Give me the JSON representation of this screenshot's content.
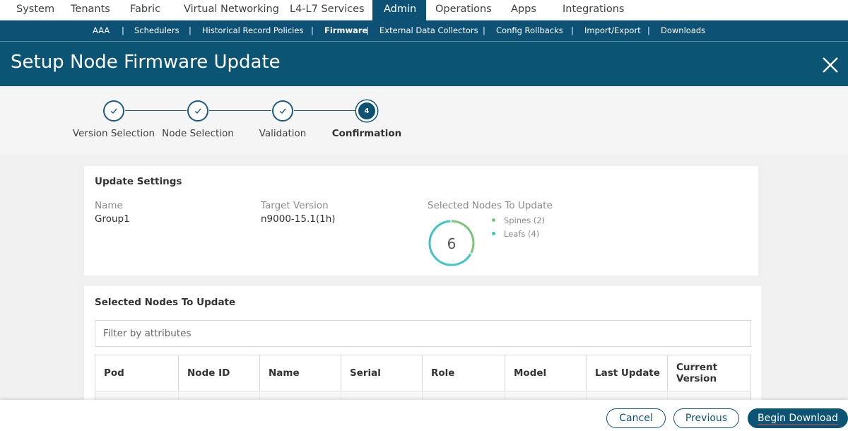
{
  "topnav": {
    "tabs": [
      {
        "label": "System"
      },
      {
        "label": "Tenants"
      },
      {
        "label": "Fabric"
      },
      {
        "label": "Virtual Networking"
      },
      {
        "label": "L4-L7 Services"
      },
      {
        "label": "Admin"
      },
      {
        "label": "Operations"
      },
      {
        "label": "Apps"
      },
      {
        "label": "Integrations"
      }
    ],
    "active": "Admin"
  },
  "subnav": {
    "items": [
      {
        "label": "AAA"
      },
      {
        "label": "Schedulers"
      },
      {
        "label": "Historical Record Policies"
      },
      {
        "label": "Firmware"
      },
      {
        "label": "External Data Collectors"
      },
      {
        "label": "Config Rollbacks"
      },
      {
        "label": "Import/Export"
      },
      {
        "label": "Downloads"
      }
    ],
    "separator": "|",
    "active": "Firmware"
  },
  "dialog": {
    "title": "Setup Node Firmware Update",
    "close_icon": "close-icon"
  },
  "stepper": {
    "steps": [
      {
        "label": "Version Selection",
        "status": "done",
        "icon": "check-icon"
      },
      {
        "label": "Node Selection",
        "status": "done",
        "icon": "check-icon"
      },
      {
        "label": "Validation",
        "status": "done",
        "icon": "check-icon"
      },
      {
        "label": "Confirmation",
        "status": "current",
        "number": "4"
      }
    ]
  },
  "update_settings": {
    "title": "Update Settings",
    "name_label": "Name",
    "name_value": "Group1",
    "target_version_label": "Target Version",
    "target_version_value": "n9000-15.1(1h)",
    "selected_nodes_label": "Selected Nodes To Update",
    "total": "6",
    "breakdown": [
      {
        "label": "Spines (2)",
        "count": 2,
        "color": "#7cc47a"
      },
      {
        "label": "Leafs (4)",
        "count": 4,
        "color": "#3fc4c7"
      }
    ]
  },
  "selected_nodes": {
    "title": "Selected Nodes To Update",
    "filter_placeholder": "Filter by attributes",
    "columns": [
      {
        "label": "Pod"
      },
      {
        "label": "Node ID"
      },
      {
        "label": "Name"
      },
      {
        "label": "Serial"
      },
      {
        "label": "Role"
      },
      {
        "label": "Model"
      },
      {
        "label": "Last Update"
      },
      {
        "label": "Current Version"
      }
    ]
  },
  "footer": {
    "cancel_label": "Cancel",
    "previous_label": "Previous",
    "begin_download_label": "Begin Download"
  },
  "colors": {
    "brand": "#0d5175",
    "spines": "#7cc47a",
    "leafs": "#3fc4c7"
  }
}
